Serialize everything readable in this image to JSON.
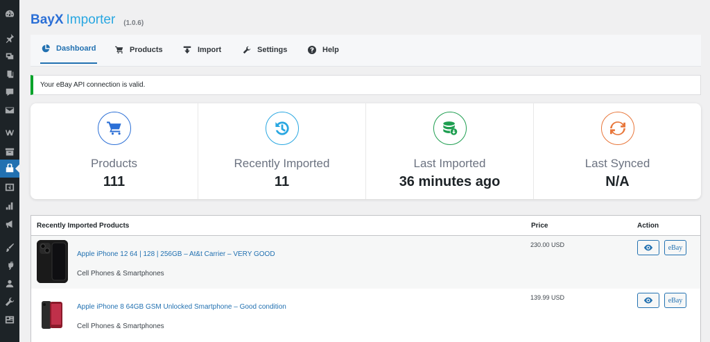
{
  "sidebar": {
    "icons": [
      "dashboard-icon",
      "pin-icon",
      "media-icon",
      "pages-icon",
      "comments-icon",
      "mail-icon",
      "woo-icon",
      "archive-icon",
      "importer-icon",
      "money-icon",
      "stats-icon",
      "megaphone-icon",
      "brush-icon",
      "plugin-icon",
      "user-icon",
      "wrench-icon",
      "settings-icon"
    ]
  },
  "header": {
    "brand_bold": "BayX",
    "brand_light": "Importer",
    "version": "(1.0.6)"
  },
  "tabs": [
    {
      "label": "Dashboard",
      "icon": "pie-chart-icon",
      "active": true
    },
    {
      "label": "Products",
      "icon": "cart-icon"
    },
    {
      "label": "Import",
      "icon": "import-icon"
    },
    {
      "label": "Settings",
      "icon": "wrench-icon"
    },
    {
      "label": "Help",
      "icon": "help-icon"
    }
  ],
  "notice": {
    "text": "Your eBay API connection is valid.",
    "color": "#00a32a"
  },
  "stats": [
    {
      "label": "Products",
      "value": "111",
      "icon": "cart-icon",
      "color": "#2b6fd6"
    },
    {
      "label": "Recently Imported",
      "value": "11",
      "icon": "history-icon",
      "color": "#29a7e1"
    },
    {
      "label": "Last Imported",
      "value": "36 minutes ago",
      "icon": "database-icon",
      "color": "#1e9e50"
    },
    {
      "label": "Last Synced",
      "value": "N/A",
      "icon": "sync-icon",
      "color": "#e8763a"
    }
  ],
  "table": {
    "headers": {
      "product": "Recently Imported Products",
      "price": "Price",
      "action": "Action"
    },
    "rows": [
      {
        "name": "Apple iPhone 12 64 | 128 | 256GB – At&t Carrier – VERY GOOD",
        "category": "Cell Phones & Smartphones",
        "price": "230.00 USD",
        "view_icon": "eye-icon",
        "ebay_label": "eBay"
      },
      {
        "name": "Apple iPhone 8 64GB GSM Unlocked Smartphone – Good condition",
        "category": "Cell Phones & Smartphones",
        "price": "139.99 USD",
        "view_icon": "eye-icon",
        "ebay_label": "eBay"
      }
    ]
  }
}
